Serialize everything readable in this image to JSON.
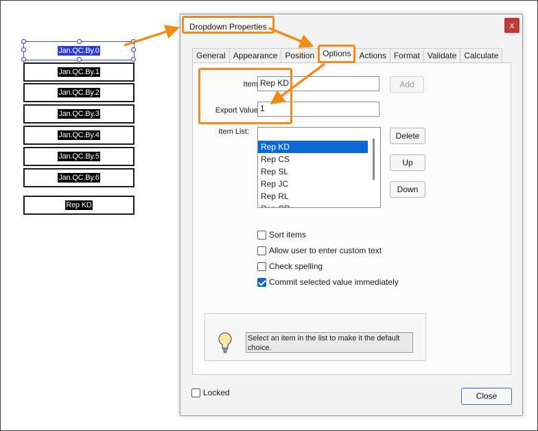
{
  "form_fields": [
    {
      "value": "Jan.QC.By.0",
      "selected": true
    },
    {
      "value": "Jan.QC.By.1"
    },
    {
      "value": "Jan.QC.By.2"
    },
    {
      "value": "Jan.QC.By.3"
    },
    {
      "value": "Jan.QC.By.4"
    },
    {
      "value": "Jan.QC.By.5"
    },
    {
      "value": "Jan.QC.By.6"
    },
    {
      "value": "Rep KD"
    }
  ],
  "dialog": {
    "title": "Dropdown Properties",
    "close_label": "x",
    "tabs": [
      "General",
      "Appearance",
      "Position",
      "Options",
      "Actions",
      "Format",
      "Validate",
      "Calculate"
    ],
    "active_tab": "Options",
    "item_label": "Item:",
    "item_value": "Rep KD",
    "export_label": "Export Value:",
    "export_value": "1",
    "add_button": "Add",
    "item_list_label": "Item List:",
    "item_list": [
      "Rep KD",
      "Rep CS",
      "Rep SL",
      "Rep JC",
      "Rep RL",
      "Rep CR"
    ],
    "selected_item": "Rep KD",
    "delete_button": "Delete",
    "up_button": "Up",
    "down_button": "Down",
    "checkboxes": [
      {
        "label": "Sort items",
        "checked": false
      },
      {
        "label": "Allow user to enter custom text",
        "checked": false
      },
      {
        "label": "Check spelling",
        "checked": false
      },
      {
        "label": "Commit selected value immediately",
        "checked": true
      }
    ],
    "hint": "Select an item in the list to make it the default choice.",
    "hint_icon": "lightbulb-icon",
    "locked_label": "Locked",
    "locked_checked": false,
    "close_button": "Close"
  },
  "colors": {
    "highlight": "#f28a17",
    "selection": "#0a69d4",
    "field_selection": "#2b3bd6"
  }
}
